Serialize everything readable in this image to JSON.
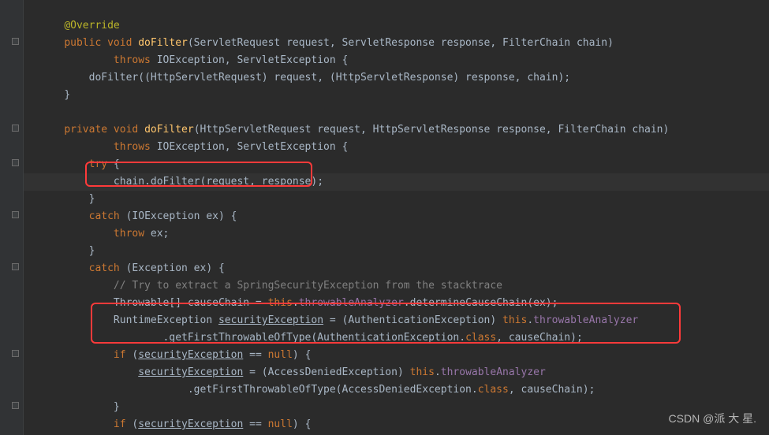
{
  "code": {
    "l1a": "@Override",
    "l2_kw1": "public void ",
    "l2_m": "doFilter",
    "l2_rest": "(ServletRequest request, ServletResponse response, FilterChain chain)",
    "l3_kw": "throws ",
    "l3_rest": "IOException, ServletException {",
    "l4a": "doFilter((HttpServletRequest) request, (HttpServletResponse) response, chain);",
    "l5": "}",
    "l6": "",
    "l7_kw1": "private void ",
    "l7_m": "doFilter",
    "l7_rest": "(HttpServletRequest request, HttpServletResponse response, FilterChain chain)",
    "l8_kw": "throws ",
    "l8_rest": "IOException, ServletException {",
    "l9_kw": "try ",
    "l9_rest": "{",
    "l10a": "chain.doFilter(request, response);",
    "l11": "}",
    "l12_kw": "catch ",
    "l12_rest": "(IOException ex) {",
    "l13_kw": "throw ",
    "l13_rest": "ex;",
    "l14": "}",
    "l15_kw": "catch ",
    "l15_rest": "(Exception ex) {",
    "l16_comment": "// Try to extract a SpringSecurityException from the stacktrace",
    "l17a": "Throwable[] causeChain = ",
    "l17_kw": "this",
    "l17b": ".",
    "l17_fld": "throwableAnalyzer",
    "l17c": ".determineCauseChain(ex);",
    "l18a": "RuntimeException ",
    "l18_var": "securityException",
    "l18b": " = (AuthenticationException) ",
    "l18_kw": "this",
    "l18c": ".",
    "l18_fld": "throwableAnalyzer",
    "l19a": ".getFirstThrowableOfType(AuthenticationException.",
    "l19_kw": "class",
    "l19b": ", causeChain);",
    "l20_kw": "if ",
    "l20a": "(",
    "l20_var": "securityException",
    "l20b": " == ",
    "l20_kw2": "null",
    "l20c": ") {",
    "l21_var": "securityException",
    "l21a": " = (AccessDeniedException) ",
    "l21_kw": "this",
    "l21b": ".",
    "l21_fld": "throwableAnalyzer",
    "l22a": ".getFirstThrowableOfType(AccessDeniedException.",
    "l22_kw": "class",
    "l22b": ", causeChain);",
    "l23": "}",
    "l24_kw": "if ",
    "l24a": "(",
    "l24_var": "securityException",
    "l24b": " == ",
    "l24_kw2": "null",
    "l24c": ") {"
  },
  "watermark": "CSDN @派 大 星."
}
